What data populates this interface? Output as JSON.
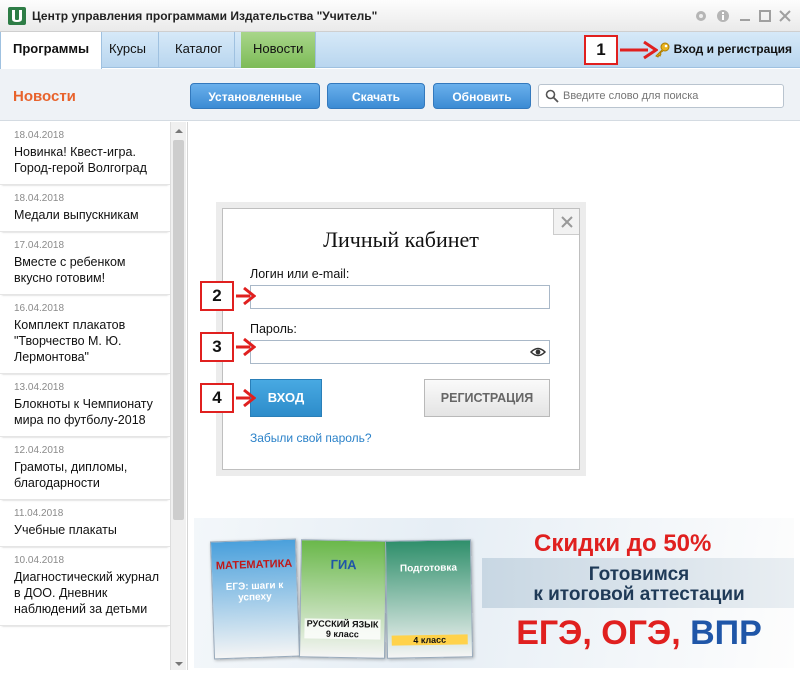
{
  "window": {
    "title": "Центр управления программами Издательства \"Учитель\""
  },
  "nav": {
    "tabs": [
      {
        "label": "Программы"
      },
      {
        "label": "Курсы"
      },
      {
        "label": "Каталог"
      },
      {
        "label": "Новости"
      }
    ],
    "login_label": "Вход и регистрация"
  },
  "callouts": [
    "1",
    "2",
    "3",
    "4"
  ],
  "toolbar": {
    "section_title": "Новости",
    "installed_label": "Установленные",
    "download_label": "Скачать",
    "update_label": "Обновить",
    "search_placeholder": "Введите слово для поиска"
  },
  "news": [
    {
      "date": "18.04.2018",
      "title": "Новинка! Квест-игра. Город-герой Волгоград"
    },
    {
      "date": "18.04.2018",
      "title": "Медали выпускникам"
    },
    {
      "date": "17.04.2018",
      "title": "Вместе с ребенком вкусно готовим!"
    },
    {
      "date": "16.04.2018",
      "title": "Комплект плакатов \"Творчество М. Ю. Лермонтова\""
    },
    {
      "date": "13.04.2018",
      "title": "Блокноты к Чемпионату мира по футболу-2018"
    },
    {
      "date": "12.04.2018",
      "title": "Грамоты, дипломы, благодарности"
    },
    {
      "date": "11.04.2018",
      "title": "Учебные плакаты"
    },
    {
      "date": "10.04.2018",
      "title": "Диагностический журнал в ДОО. Дневник наблюдений за детьми"
    }
  ],
  "login_dialog": {
    "title": "Личный кабинет",
    "login_label": "Логин или e-mail:",
    "login_value": "",
    "password_label": "Пароль:",
    "password_value": "",
    "submit_label": "ВХОД",
    "register_label": "РЕГИСТРАЦИЯ",
    "forgot_label": "Забыли свой пароль?"
  },
  "banner": {
    "sale": "Скидки до 50%",
    "line1": "Готовимся",
    "line2": "к итоговой аттестации",
    "exams": [
      "ЕГЭ",
      "ОГЭ",
      "ВПР"
    ],
    "exam_colors": [
      "#e0201f",
      "#e0201f",
      "#1f56a8"
    ],
    "books": [
      {
        "title": "МАТЕМАТИКА",
        "subtitle": "ЕГЭ: шаги к успеху",
        "color": "#4aa0dc"
      },
      {
        "title": "ГИА",
        "subtitle": "РУССКИЙ ЯЗЫК 9 класс",
        "color": "#6ab84a"
      },
      {
        "title": "Подготовка",
        "subtitle": "4 класс",
        "color": "#2f8f6b"
      }
    ]
  },
  "colors": {
    "accent": "#3b8bd4",
    "section_title": "#e8632c",
    "callout_border": "#e0201f",
    "news_tab": "#7dbb57"
  }
}
